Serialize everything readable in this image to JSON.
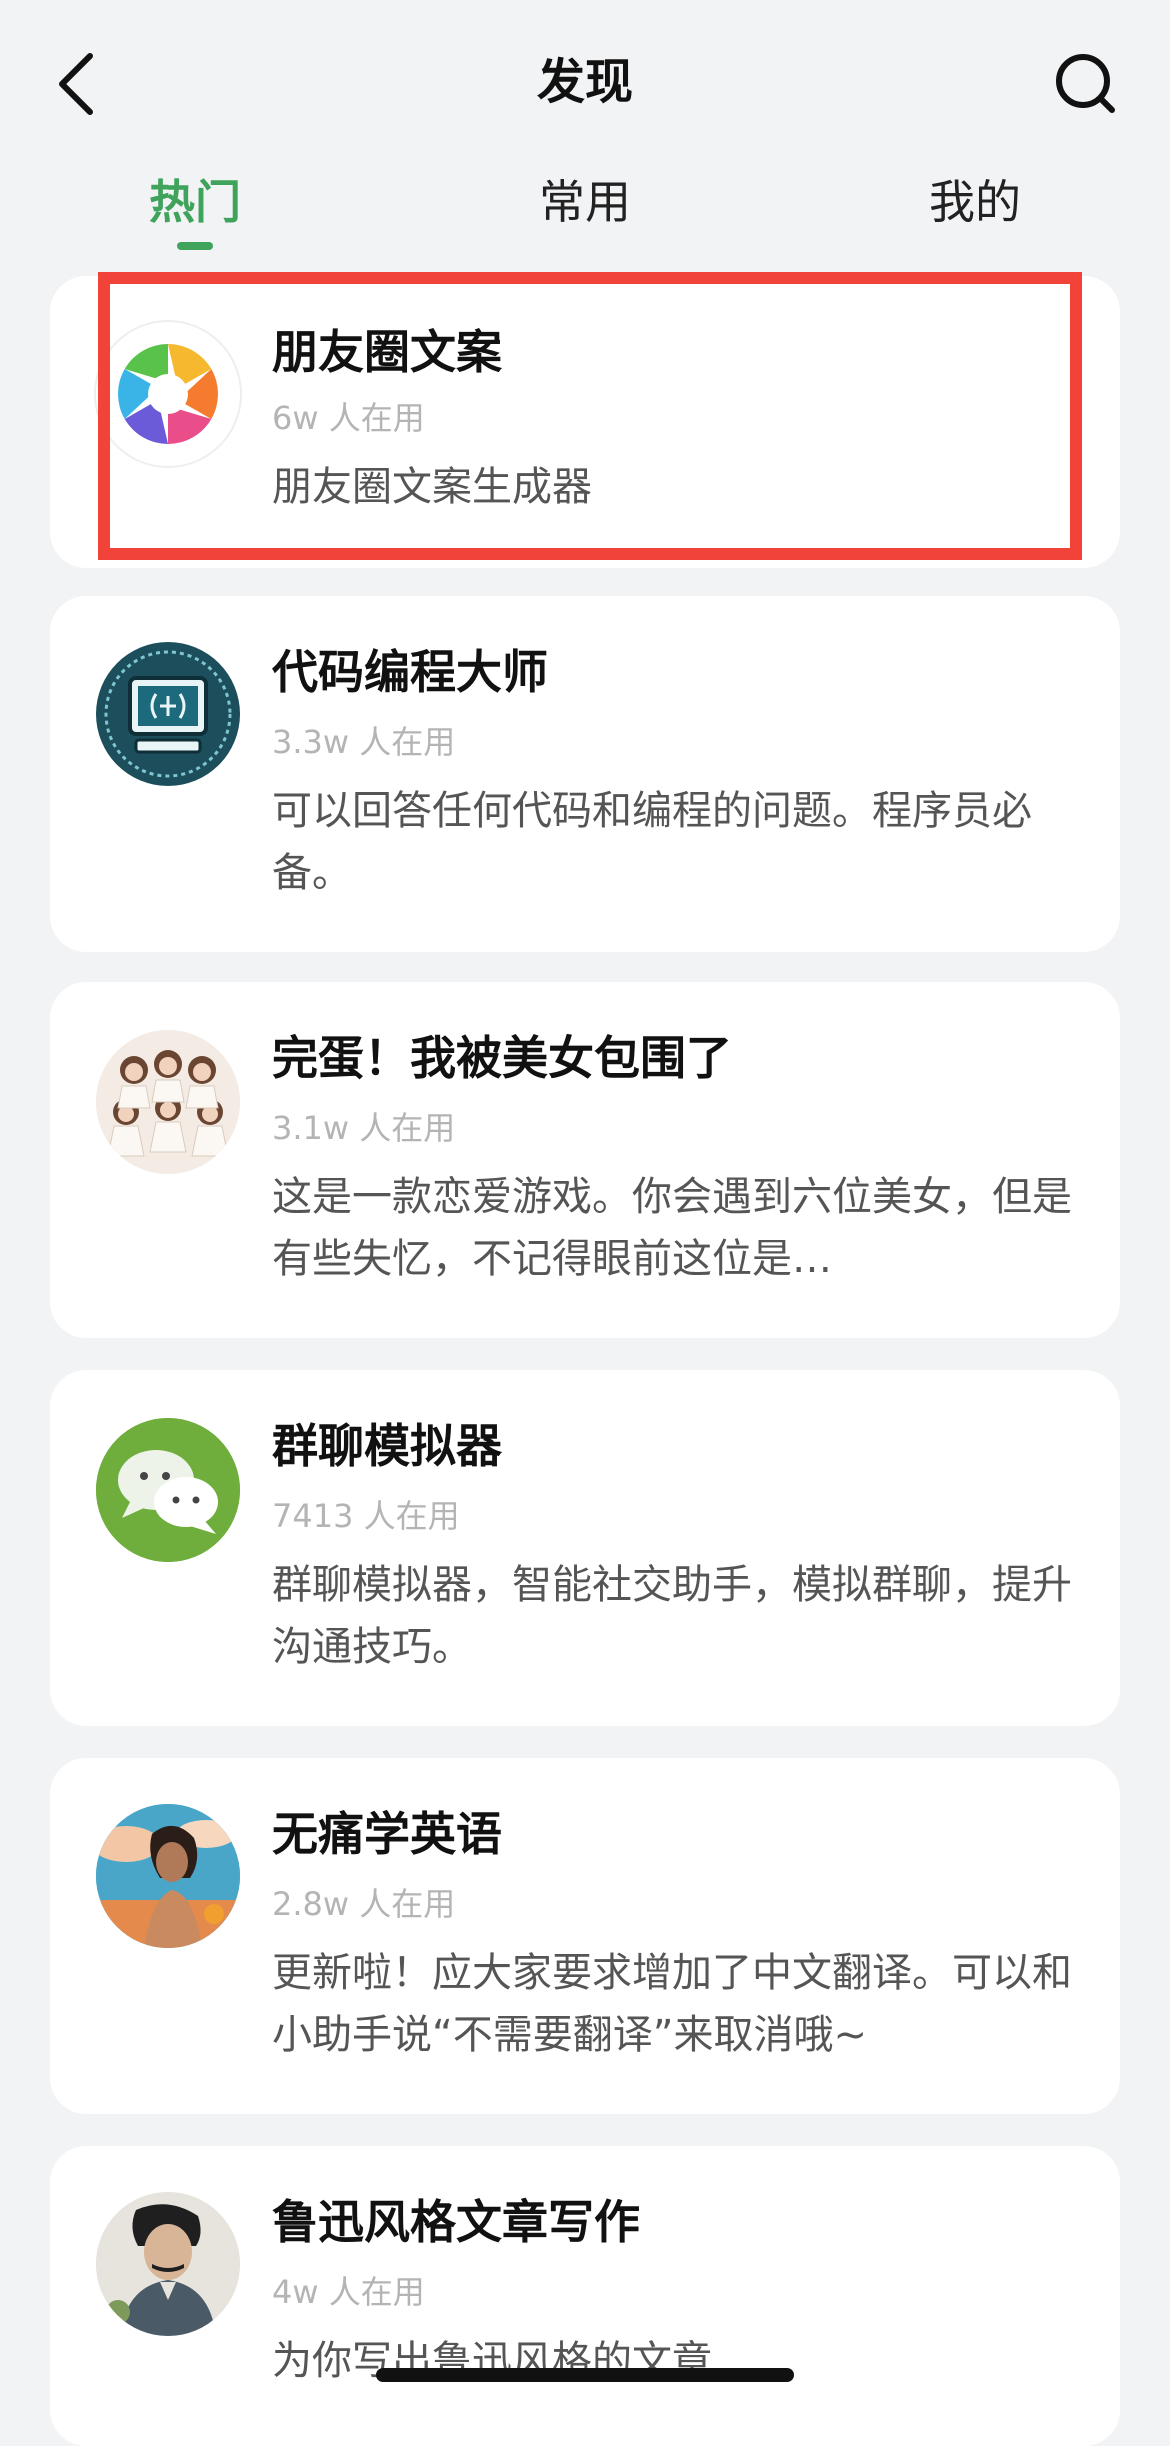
{
  "header": {
    "title": "发现"
  },
  "tabs": [
    {
      "label": "热门",
      "active": true
    },
    {
      "label": "常用",
      "active": false
    },
    {
      "label": "我的",
      "active": false
    }
  ],
  "cards": [
    {
      "title": "朋友圈文案",
      "users": "6w 人在用",
      "description": "朋友圈文案生成器",
      "icon": "aperture-icon"
    },
    {
      "title": "代码编程大师",
      "users": "3.3w 人在用",
      "description": "可以回答任何代码和编程的问题。程序员必备。",
      "icon": "computer-brain-icon"
    },
    {
      "title": "完蛋！我被美女包围了",
      "users": "3.1w 人在用",
      "description": "这是一款恋爱游戏。你会遇到六位美女，但是有些失忆，不记得眼前这位是…",
      "icon": "group-women-avatar"
    },
    {
      "title": "群聊模拟器",
      "users": "7413 人在用",
      "description": "群聊模拟器，智能社交助手，模拟群聊，提升沟通技巧。",
      "icon": "chat-bubbles-icon"
    },
    {
      "title": "无痛学英语",
      "users": "2.8w 人在用",
      "description": "更新啦！应大家要求增加了中文翻译。可以和小助手说“不需要翻译”来取消哦~",
      "icon": "woman-portrait-avatar"
    },
    {
      "title": "鲁迅风格文章写作",
      "users": "4w 人在用",
      "description": "为你写出鲁迅风格的文章",
      "icon": "luxun-portrait-avatar"
    }
  ],
  "colors": {
    "background": "#f2f3f5",
    "accent_green": "#3fa35b",
    "highlight_red": "#f2433b",
    "secondary_text": "#b4b4b4"
  }
}
